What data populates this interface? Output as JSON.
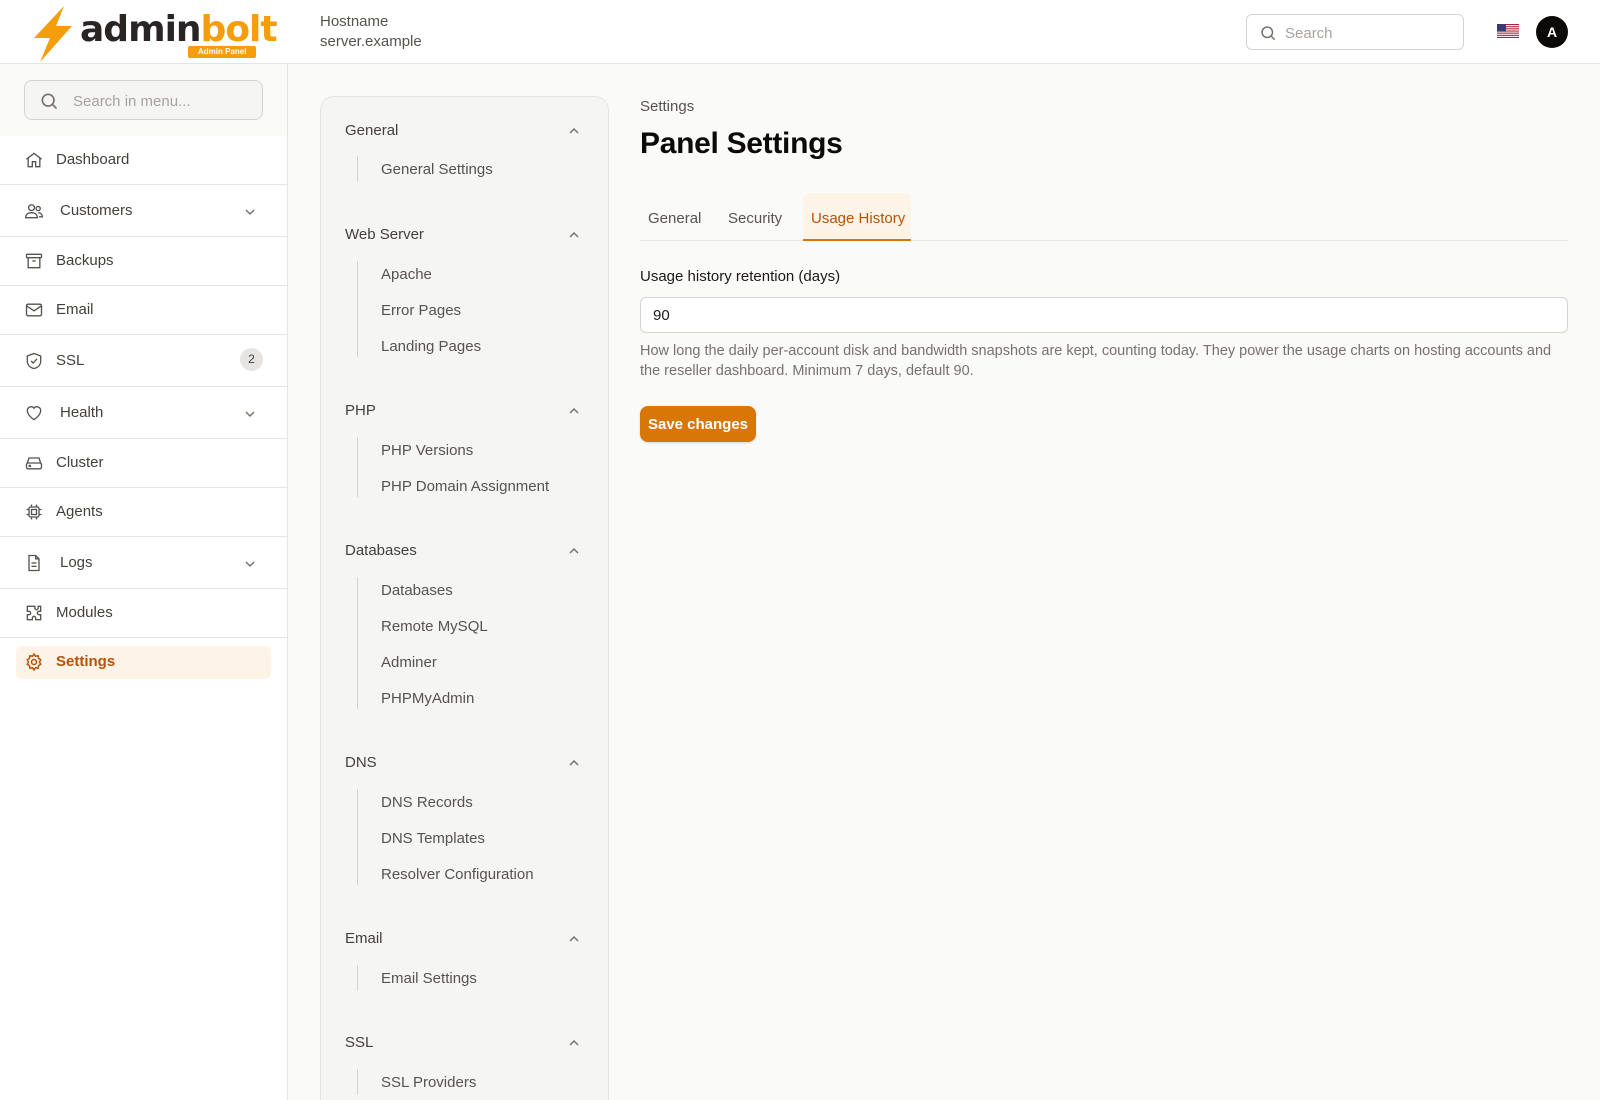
{
  "brand": {
    "name_dark": "admin",
    "name_accent": "bolt",
    "badge": "Admin Panel"
  },
  "header": {
    "hostname_label": "Hostname",
    "hostname_value": "server.example",
    "search_placeholder": "Search",
    "avatar_initial": "A",
    "flag": "us-flag-icon"
  },
  "sidebar": {
    "search_placeholder": "Search in menu...",
    "items": [
      {
        "label": "Dashboard",
        "icon": "home-icon"
      },
      {
        "label": "Customers",
        "icon": "users-icon",
        "expandable": true
      },
      {
        "label": "Backups",
        "icon": "archive-icon"
      },
      {
        "label": "Email",
        "icon": "mail-icon"
      },
      {
        "label": "SSL",
        "icon": "shield-check-icon",
        "badge": "2"
      },
      {
        "label": "Health",
        "icon": "heart-icon",
        "expandable": true
      },
      {
        "label": "Cluster",
        "icon": "server-icon"
      },
      {
        "label": "Agents",
        "icon": "cpu-icon"
      },
      {
        "label": "Logs",
        "icon": "file-icon",
        "expandable": true
      },
      {
        "label": "Modules",
        "icon": "puzzle-icon"
      },
      {
        "label": "Settings",
        "icon": "settings-icon",
        "active": true
      }
    ]
  },
  "submenu": {
    "groups": [
      {
        "title": "General",
        "links": [
          "General Settings"
        ]
      },
      {
        "title": "Web Server",
        "links": [
          "Apache",
          "Error Pages",
          "Landing Pages"
        ]
      },
      {
        "title": "PHP",
        "links": [
          "PHP Versions",
          "PHP Domain Assignment"
        ]
      },
      {
        "title": "Databases",
        "links": [
          "Databases",
          "Remote MySQL",
          "Adminer",
          "PHPMyAdmin"
        ]
      },
      {
        "title": "DNS",
        "links": [
          "DNS Records",
          "DNS Templates",
          "Resolver Configuration"
        ]
      },
      {
        "title": "Email",
        "links": [
          "Email Settings"
        ]
      },
      {
        "title": "SSL",
        "links": [
          "SSL Providers"
        ]
      }
    ]
  },
  "main": {
    "breadcrumb": "Settings",
    "title": "Panel Settings",
    "tabs": [
      {
        "label": "General"
      },
      {
        "label": "Security"
      },
      {
        "label": "Usage History",
        "active": true
      }
    ],
    "field_label": "Usage history retention (days)",
    "field_value": "90",
    "help_text": "How long the daily per-account disk and bandwidth snapshots are kept, counting today. They power the usage charts on hosting accounts and the reseller dashboard. Minimum 7 days, default 90.",
    "save_label": "Save changes"
  },
  "colors": {
    "accent": "#d97706",
    "accent_bg": "#fef3e7",
    "accent_text": "#b45309"
  }
}
